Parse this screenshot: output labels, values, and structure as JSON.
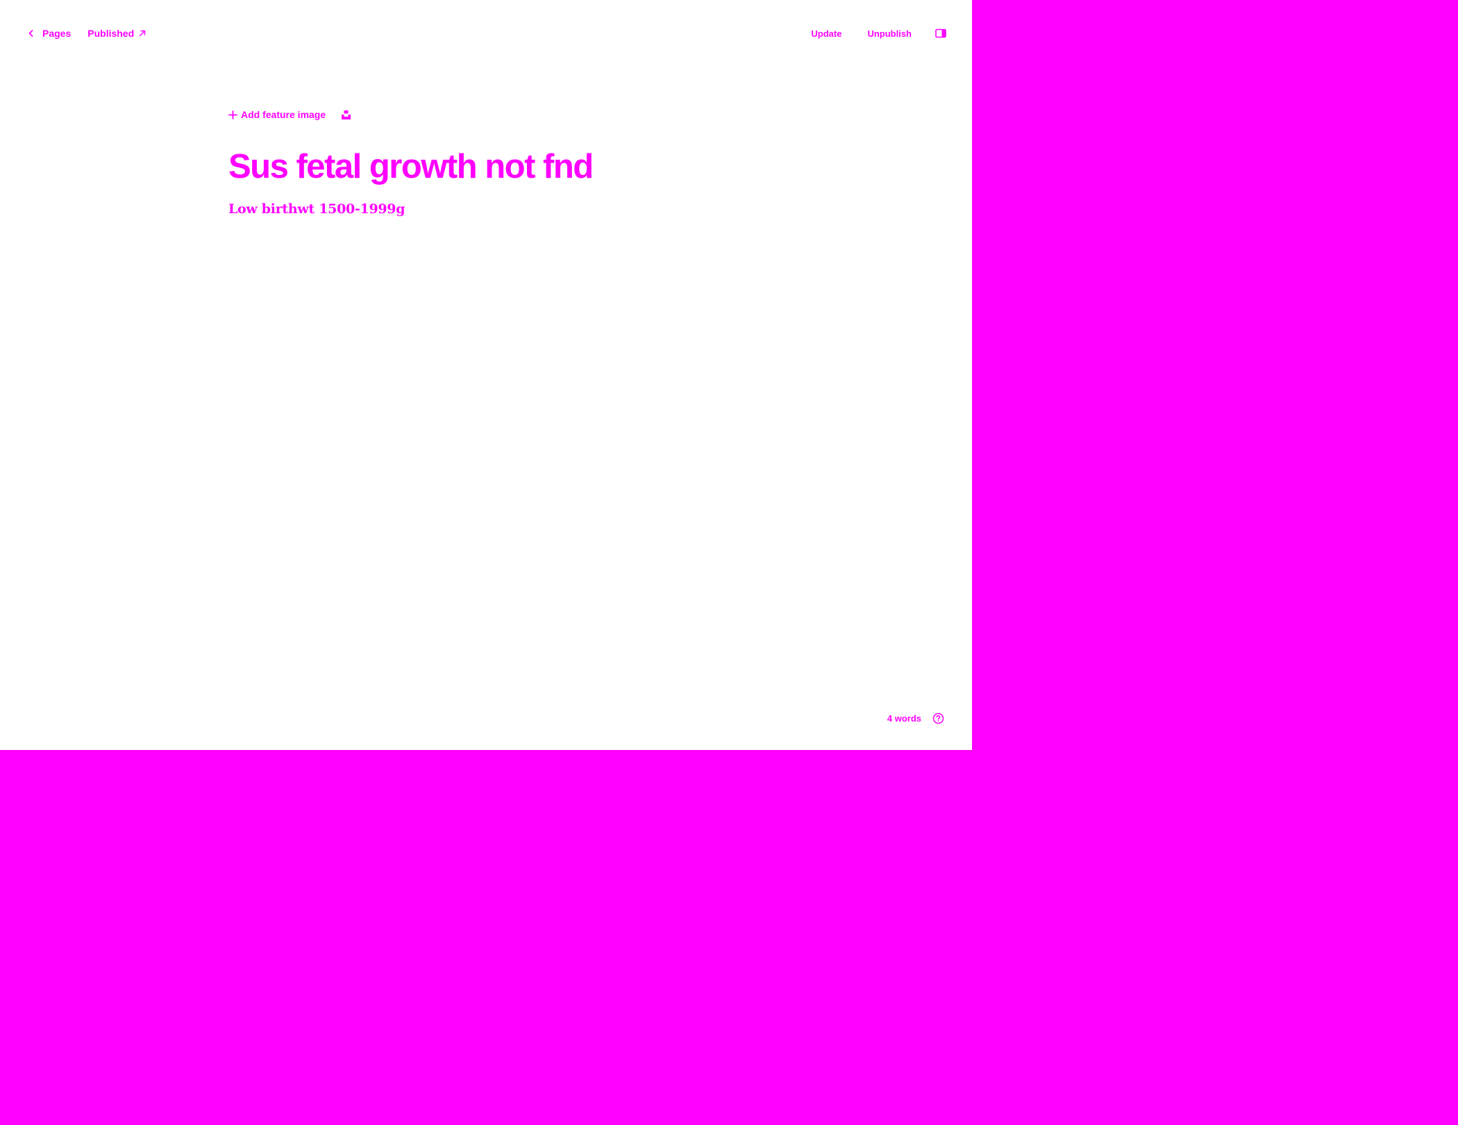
{
  "topbar": {
    "back_label": "Pages",
    "status_label": "Published",
    "update_label": "Update",
    "unpublish_label": "Unpublish"
  },
  "editor": {
    "add_feature_image_label": "Add feature image",
    "title": "Sus fetal growth not fnd",
    "excerpt": "Low birthwt 1500-1999g"
  },
  "footer": {
    "word_count": "4 words"
  },
  "icons": {
    "back": "chevron-left-icon",
    "status": "arrow-up-right-icon",
    "sidebar": "sidebar-toggle-icon",
    "add": "plus-icon",
    "unsplash": "unsplash-icon",
    "help": "question-circle-icon"
  },
  "colors": {
    "accent": "#ff00ff",
    "background": "#ffffff"
  }
}
